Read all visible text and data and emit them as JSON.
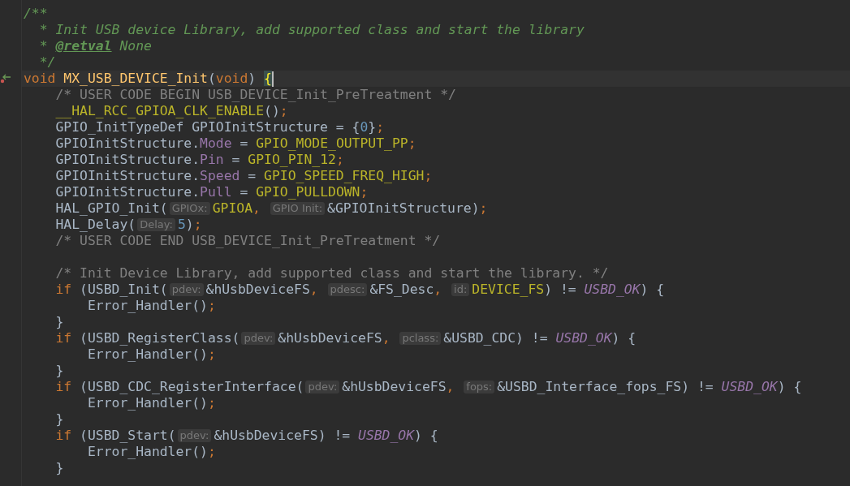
{
  "editor": {
    "lines": [
      {
        "caret": false,
        "gutter_mark": false,
        "tokens": [
          {
            "kind": "doc",
            "text": "/**"
          }
        ]
      },
      {
        "caret": false,
        "gutter_mark": false,
        "tokens": [
          {
            "kind": "doc",
            "text": "  * Init USB device Library, add supported class and start the library"
          }
        ]
      },
      {
        "caret": false,
        "gutter_mark": false,
        "tokens": [
          {
            "kind": "doc",
            "text": "  * "
          },
          {
            "kind": "doctag",
            "text": "@retval"
          },
          {
            "kind": "doc",
            "text": " None"
          }
        ]
      },
      {
        "caret": false,
        "gutter_mark": false,
        "tokens": [
          {
            "kind": "doc",
            "text": "  */"
          }
        ]
      },
      {
        "caret": true,
        "gutter_mark": true,
        "tokens": [
          {
            "kind": "keyword",
            "text": "void "
          },
          {
            "kind": "func",
            "text": "MX_USB_DEVICE_Init"
          },
          {
            "kind": "plain",
            "text": "("
          },
          {
            "kind": "keyword",
            "text": "void"
          },
          {
            "kind": "plain",
            "text": ") "
          },
          {
            "kind": "brace",
            "text": "{"
          }
        ]
      },
      {
        "caret": false,
        "gutter_mark": false,
        "tokens": [
          {
            "kind": "comment",
            "text": "    /* USER CODE BEGIN USB_DEVICE_Init_PreTreatment */"
          }
        ]
      },
      {
        "caret": false,
        "gutter_mark": false,
        "tokens": [
          {
            "kind": "macro",
            "text": "    __HAL_RCC_GPIOA_CLK_ENABLE"
          },
          {
            "kind": "plain",
            "text": "()"
          },
          {
            "kind": "punct",
            "text": ";"
          }
        ]
      },
      {
        "caret": false,
        "gutter_mark": false,
        "tokens": [
          {
            "kind": "plain",
            "text": "    GPIO_InitTypeDef GPIOInitStructure = {"
          },
          {
            "kind": "number",
            "text": "0"
          },
          {
            "kind": "plain",
            "text": "}"
          },
          {
            "kind": "punct",
            "text": ";"
          }
        ]
      },
      {
        "caret": false,
        "gutter_mark": false,
        "tokens": [
          {
            "kind": "plain",
            "text": "    GPIOInitStructure."
          },
          {
            "kind": "field",
            "text": "Mode"
          },
          {
            "kind": "plain",
            "text": " = "
          },
          {
            "kind": "macro",
            "text": "GPIO_MODE_OUTPUT_PP"
          },
          {
            "kind": "punct",
            "text": ";"
          }
        ]
      },
      {
        "caret": false,
        "gutter_mark": false,
        "tokens": [
          {
            "kind": "plain",
            "text": "    GPIOInitStructure."
          },
          {
            "kind": "field",
            "text": "Pin"
          },
          {
            "kind": "plain",
            "text": " = "
          },
          {
            "kind": "macro",
            "text": "GPIO_PIN_12"
          },
          {
            "kind": "punct",
            "text": ";"
          }
        ]
      },
      {
        "caret": false,
        "gutter_mark": false,
        "tokens": [
          {
            "kind": "plain",
            "text": "    GPIOInitStructure."
          },
          {
            "kind": "field",
            "text": "Speed"
          },
          {
            "kind": "plain",
            "text": " = "
          },
          {
            "kind": "macro",
            "text": "GPIO_SPEED_FREQ_HIGH"
          },
          {
            "kind": "punct",
            "text": ";"
          }
        ]
      },
      {
        "caret": false,
        "gutter_mark": false,
        "tokens": [
          {
            "kind": "plain",
            "text": "    GPIOInitStructure."
          },
          {
            "kind": "field",
            "text": "Pull"
          },
          {
            "kind": "plain",
            "text": " = "
          },
          {
            "kind": "macro",
            "text": "GPIO_PULLDOWN"
          },
          {
            "kind": "punct",
            "text": ";"
          }
        ]
      },
      {
        "caret": false,
        "gutter_mark": false,
        "tokens": [
          {
            "kind": "plain",
            "text": "    HAL_GPIO_Init("
          },
          {
            "kind": "hint",
            "text": "GPIOx:"
          },
          {
            "kind": "macro",
            "text": "GPIOA"
          },
          {
            "kind": "punct",
            "text": ", "
          },
          {
            "kind": "hint",
            "text": "GPIO Init:"
          },
          {
            "kind": "plain",
            "text": "&GPIOInitStructure)"
          },
          {
            "kind": "punct",
            "text": ";"
          }
        ]
      },
      {
        "caret": false,
        "gutter_mark": false,
        "tokens": [
          {
            "kind": "plain",
            "text": "    HAL_Delay("
          },
          {
            "kind": "hint",
            "text": "Delay:"
          },
          {
            "kind": "number",
            "text": "5"
          },
          {
            "kind": "plain",
            "text": ")"
          },
          {
            "kind": "punct",
            "text": ";"
          }
        ]
      },
      {
        "caret": false,
        "gutter_mark": false,
        "tokens": [
          {
            "kind": "comment",
            "text": "    /* USER CODE END USB_DEVICE_Init_PreTreatment */"
          }
        ]
      },
      {
        "caret": false,
        "gutter_mark": false
      },
      {
        "caret": false,
        "gutter_mark": false,
        "tokens": [
          {
            "kind": "comment",
            "text": "    /* Init Device Library, add supported class and start the library. */"
          }
        ]
      },
      {
        "caret": false,
        "gutter_mark": false,
        "tokens": [
          {
            "kind": "keyword",
            "text": "    if"
          },
          {
            "kind": "plain",
            "text": " (USBD_Init("
          },
          {
            "kind": "hint",
            "text": "pdev:"
          },
          {
            "kind": "plain",
            "text": "&hUsbDeviceFS"
          },
          {
            "kind": "punct",
            "text": ", "
          },
          {
            "kind": "hint",
            "text": "pdesc:"
          },
          {
            "kind": "plain",
            "text": "&FS_Desc"
          },
          {
            "kind": "punct",
            "text": ", "
          },
          {
            "kind": "hint",
            "text": "id:"
          },
          {
            "kind": "macro",
            "text": "DEVICE_FS"
          },
          {
            "kind": "plain",
            "text": ") != "
          },
          {
            "kind": "enum",
            "text": "USBD_OK"
          },
          {
            "kind": "plain",
            "text": ") {"
          }
        ]
      },
      {
        "caret": false,
        "gutter_mark": false,
        "tokens": [
          {
            "kind": "plain",
            "text": "        Error_Handler()"
          },
          {
            "kind": "punct",
            "text": ";"
          }
        ]
      },
      {
        "caret": false,
        "gutter_mark": false,
        "tokens": [
          {
            "kind": "plain",
            "text": "    }"
          }
        ]
      },
      {
        "caret": false,
        "gutter_mark": false,
        "tokens": [
          {
            "kind": "keyword",
            "text": "    if"
          },
          {
            "kind": "plain",
            "text": " (USBD_RegisterClass("
          },
          {
            "kind": "hint",
            "text": "pdev:"
          },
          {
            "kind": "plain",
            "text": "&hUsbDeviceFS"
          },
          {
            "kind": "punct",
            "text": ", "
          },
          {
            "kind": "hint",
            "text": "pclass:"
          },
          {
            "kind": "plain",
            "text": "&USBD_CDC) != "
          },
          {
            "kind": "enum",
            "text": "USBD_OK"
          },
          {
            "kind": "plain",
            "text": ") {"
          }
        ]
      },
      {
        "caret": false,
        "gutter_mark": false,
        "tokens": [
          {
            "kind": "plain",
            "text": "        Error_Handler()"
          },
          {
            "kind": "punct",
            "text": ";"
          }
        ]
      },
      {
        "caret": false,
        "gutter_mark": false,
        "tokens": [
          {
            "kind": "plain",
            "text": "    }"
          }
        ]
      },
      {
        "caret": false,
        "gutter_mark": false,
        "tokens": [
          {
            "kind": "keyword",
            "text": "    if"
          },
          {
            "kind": "plain",
            "text": " (USBD_CDC_RegisterInterface("
          },
          {
            "kind": "hint",
            "text": "pdev:"
          },
          {
            "kind": "plain",
            "text": "&hUsbDeviceFS"
          },
          {
            "kind": "punct",
            "text": ", "
          },
          {
            "kind": "hint",
            "text": "fops:"
          },
          {
            "kind": "plain",
            "text": "&USBD_Interface_fops_FS) != "
          },
          {
            "kind": "enum",
            "text": "USBD_OK"
          },
          {
            "kind": "plain",
            "text": ") {"
          }
        ]
      },
      {
        "caret": false,
        "gutter_mark": false,
        "tokens": [
          {
            "kind": "plain",
            "text": "        Error_Handler()"
          },
          {
            "kind": "punct",
            "text": ";"
          }
        ]
      },
      {
        "caret": false,
        "gutter_mark": false,
        "tokens": [
          {
            "kind": "plain",
            "text": "    }"
          }
        ]
      },
      {
        "caret": false,
        "gutter_mark": false,
        "tokens": [
          {
            "kind": "keyword",
            "text": "    if"
          },
          {
            "kind": "plain",
            "text": " (USBD_Start("
          },
          {
            "kind": "hint",
            "text": "pdev:"
          },
          {
            "kind": "plain",
            "text": "&hUsbDeviceFS) != "
          },
          {
            "kind": "enum",
            "text": "USBD_OK"
          },
          {
            "kind": "plain",
            "text": ") {"
          }
        ]
      },
      {
        "caret": false,
        "gutter_mark": false,
        "tokens": [
          {
            "kind": "plain",
            "text": "        Error_Handler()"
          },
          {
            "kind": "punct",
            "text": ";"
          }
        ]
      },
      {
        "caret": false,
        "gutter_mark": false,
        "tokens": [
          {
            "kind": "plain",
            "text": "    }"
          }
        ]
      }
    ]
  }
}
